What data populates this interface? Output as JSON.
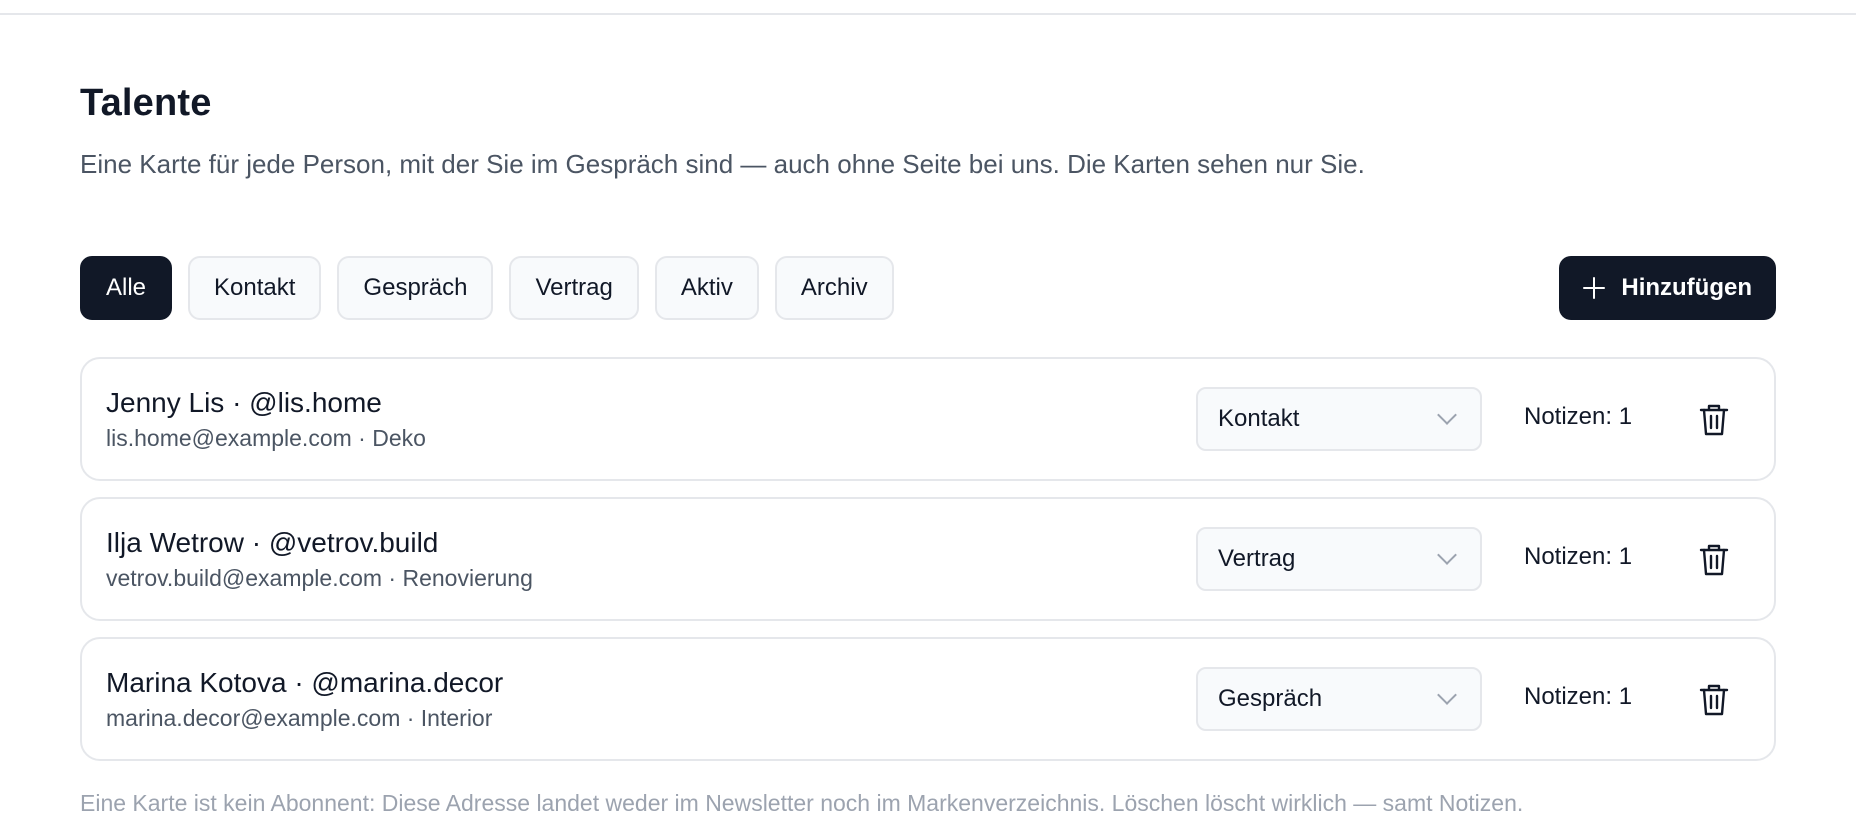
{
  "header": {
    "title": "Talente",
    "description": "Eine Karte für jede Person, mit der Sie im Gespräch sind — auch ohne Seite bei uns. Die Karten sehen nur Sie."
  },
  "filters": {
    "active": "Alle",
    "items": [
      {
        "label": "Alle"
      },
      {
        "label": "Kontakt"
      },
      {
        "label": "Gespräch"
      },
      {
        "label": "Vertrag"
      },
      {
        "label": "Aktiv"
      },
      {
        "label": "Archiv"
      }
    ]
  },
  "actions": {
    "add_label": "Hinzufügen",
    "add_icon": "plus-icon"
  },
  "cards": [
    {
      "name": "Jenny Lis · @lis.home",
      "meta": "lis.home@example.com · Deko",
      "status": "Kontakt",
      "notes": "Notizen: 1"
    },
    {
      "name": "Ilja Wetrow · @vetrov.build",
      "meta": "vetrov.build@example.com · Renovierung",
      "status": "Vertrag",
      "notes": "Notizen: 1"
    },
    {
      "name": "Marina Kotova · @marina.decor",
      "meta": "marina.decor@example.com · Interior",
      "status": "Gespräch",
      "notes": "Notizen: 1"
    }
  ],
  "footer": {
    "note": "Eine Karte ist kein Abonnent: Diese Adresse landet weder im Newsletter noch im Markenverzeichnis. Löschen löscht wirklich — samt Notizen."
  },
  "colors": {
    "primary": "#111827",
    "muted_text": "#4b5563",
    "faint_text": "#9ca3af",
    "border": "#e5e7eb",
    "chip_bg": "#f8fafc"
  }
}
